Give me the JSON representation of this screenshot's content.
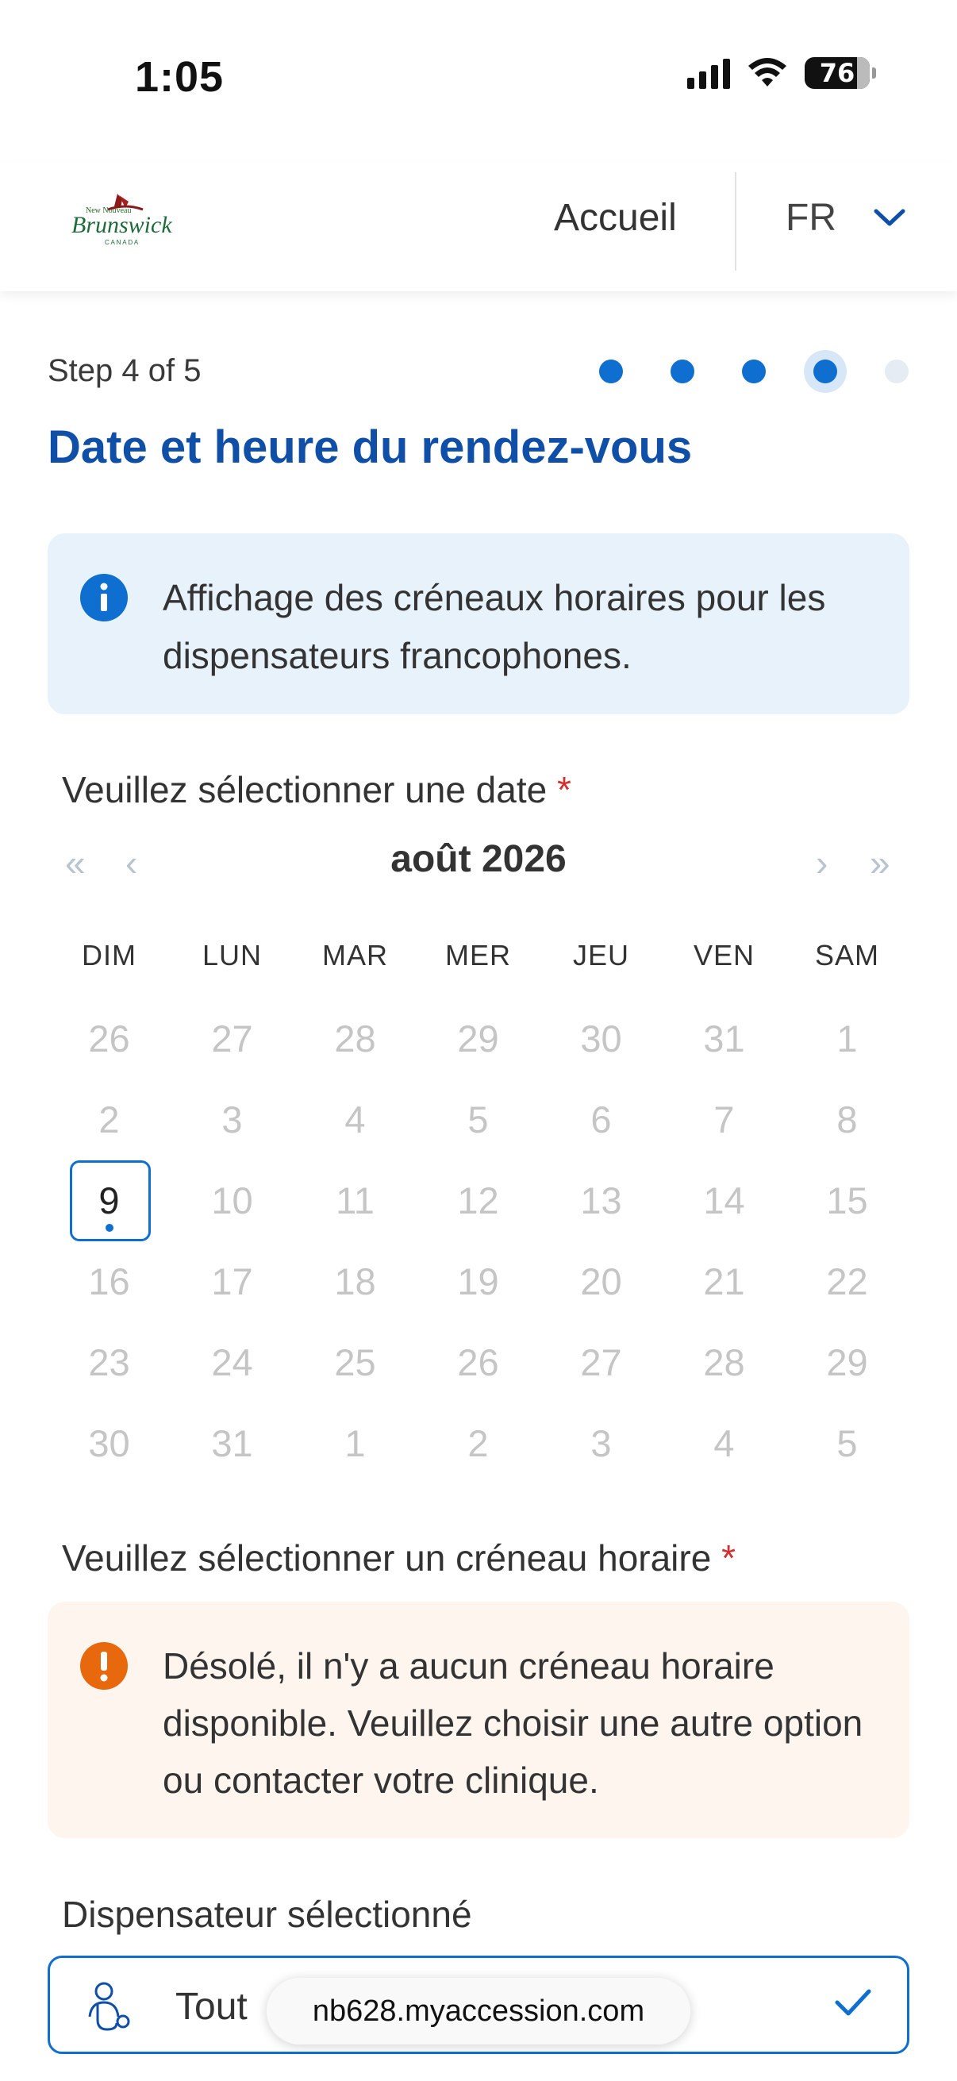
{
  "status_bar": {
    "time": "1:05",
    "battery": "76"
  },
  "header": {
    "logo_text_top": "New Nouveau",
    "logo_text_main": "Brunswick",
    "logo_text_bottom": "C A N A D A",
    "nav_home": "Accueil",
    "language": "FR"
  },
  "stepper": {
    "label": "Step 4 of 5",
    "total": 5,
    "current": 4
  },
  "page": {
    "title": "Date et heure du rendez-vous"
  },
  "info_banner": {
    "text": "Affichage des créneaux horaires pour les dispensateurs francophones."
  },
  "calendar": {
    "label": "Veuillez sélectionner une date",
    "required_mark": "*",
    "month": "août 2026",
    "nav_prev_year": "«",
    "nav_prev_month": "‹",
    "nav_next_month": "›",
    "nav_next_year": "»",
    "weekdays": [
      "DIM",
      "LUN",
      "MAR",
      "MER",
      "JEU",
      "VEN",
      "SAM"
    ],
    "weeks": [
      [
        "26",
        "27",
        "28",
        "29",
        "30",
        "31",
        "1"
      ],
      [
        "2",
        "3",
        "4",
        "5",
        "6",
        "7",
        "8"
      ],
      [
        "9",
        "10",
        "11",
        "12",
        "13",
        "14",
        "15"
      ],
      [
        "16",
        "17",
        "18",
        "19",
        "20",
        "21",
        "22"
      ],
      [
        "23",
        "24",
        "25",
        "26",
        "27",
        "28",
        "29"
      ],
      [
        "30",
        "31",
        "1",
        "2",
        "3",
        "4",
        "5"
      ]
    ],
    "selected_day": "9"
  },
  "timeslot": {
    "label": "Veuillez sélectionner un créneau horaire",
    "required_mark": "*",
    "warning": "Désolé, il n'y a aucun créneau horaire disponible. Veuillez choisir une autre option ou contacter votre clinique."
  },
  "provider": {
    "label": "Dispensateur sélectionné",
    "value": "Tout"
  },
  "browser": {
    "url": "nb628.myaccession.com"
  },
  "colors": {
    "primary": "#0e6fd1",
    "title": "#0f4fa8",
    "info_bg": "#e8f2fb",
    "warning_bg": "#fdf5ee",
    "warning_icon": "#e8680d",
    "required": "#d32f2f"
  }
}
